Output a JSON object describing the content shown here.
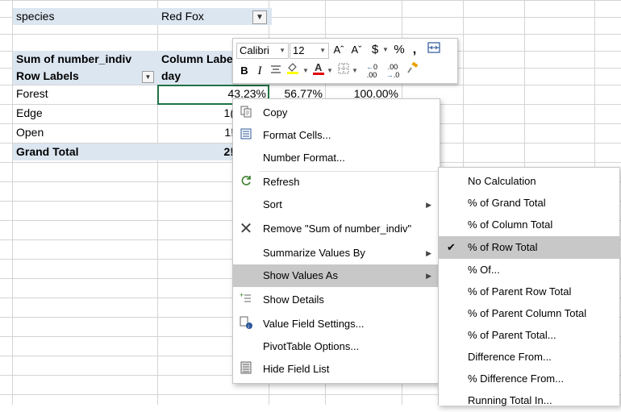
{
  "sheet": {
    "filter_field": "species",
    "filter_value": "Red Fox",
    "values_header": "Sum of number_indiv",
    "column_labels_header": "Column Labels",
    "row_labels_header": "Row Labels",
    "column_sub_header": "day",
    "rows": [
      {
        "label": "Forest",
        "values": [
          "43.23%",
          "56.77%",
          "100.00%"
        ]
      },
      {
        "label": "Edge",
        "values": [
          "1(",
          "",
          ""
        ]
      },
      {
        "label": "Open",
        "values": [
          "1!",
          "",
          ""
        ]
      },
      {
        "label": "Grand Total",
        "values": [
          "2!",
          "",
          ""
        ]
      }
    ]
  },
  "mini_toolbar": {
    "font_name": "Calibri",
    "font_size": "12",
    "grow_font": "Aˆ",
    "shrink_font": "Aˇ",
    "currency": "$",
    "percent": "%",
    "comma": ",",
    "bold": "B",
    "italic": "I",
    "increase_decimal": ".00",
    "decrease_decimal": ".0"
  },
  "context_menu": {
    "items": [
      {
        "label": "Copy",
        "icon": "copy-icon"
      },
      {
        "label": "Format Cells...",
        "icon": "format-cells-icon"
      },
      {
        "label": "Number Format...",
        "icon": ""
      },
      {
        "label": "Refresh",
        "icon": "refresh-icon"
      },
      {
        "label": "Sort",
        "icon": "",
        "submenu": true
      },
      {
        "label": "Remove \"Sum of number_indiv\"",
        "icon": "remove-icon"
      },
      {
        "label": "Summarize Values By",
        "icon": "",
        "submenu": true
      },
      {
        "label": "Show Values As",
        "icon": "",
        "submenu": true,
        "highlighted": true
      },
      {
        "label": "Show Details",
        "icon": "show-details-icon"
      },
      {
        "label": "Value Field Settings...",
        "icon": "value-field-settings-icon"
      },
      {
        "label": "PivotTable Options...",
        "icon": ""
      },
      {
        "label": "Hide Field List",
        "icon": "field-list-icon"
      }
    ]
  },
  "show_values_as_submenu": {
    "items": [
      {
        "label": "No Calculation",
        "checked": false
      },
      {
        "label": "% of Grand Total",
        "checked": false
      },
      {
        "label": "% of Column Total",
        "checked": false
      },
      {
        "label": "% of Row Total",
        "checked": true
      },
      {
        "label": "% Of...",
        "checked": false
      },
      {
        "label": "% of Parent Row Total",
        "checked": false
      },
      {
        "label": "% of Parent Column Total",
        "checked": false
      },
      {
        "label": "% of Parent Total...",
        "checked": false
      },
      {
        "label": "Difference From...",
        "checked": false
      },
      {
        "label": "% Difference From...",
        "checked": false
      },
      {
        "label": "Running Total In...",
        "checked": false
      }
    ]
  },
  "colors": {
    "pivot_header_fill": "#dce6f1",
    "selection_border": "#217346",
    "menu_highlight": "#c8c8c8",
    "font_color_underline": "#e00000"
  }
}
